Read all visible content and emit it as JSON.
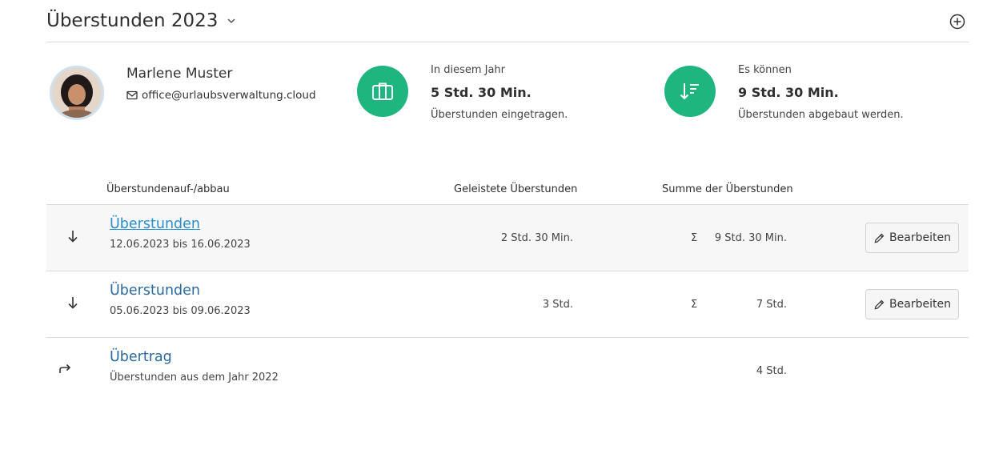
{
  "header": {
    "title": "Überstunden 2023"
  },
  "person": {
    "name": "Marlene Muster",
    "email": "office@urlaubsverwaltung.cloud"
  },
  "stats": {
    "year": {
      "label": "In diesem Jahr",
      "value": "5 Std. 30 Min.",
      "desc": "Überstunden eingetragen."
    },
    "reducible": {
      "label": "Es können",
      "value": "9 Std. 30 Min.",
      "desc": "Überstunden abgebaut werden."
    }
  },
  "colors": {
    "accent_green": "#1fb57f",
    "link_blue": "#2b6a9f"
  },
  "table": {
    "columns": {
      "type": "Überstundenauf-/abbau",
      "worked": "Geleistete Überstunden",
      "sum": "Summe der Überstunden"
    },
    "rows": [
      {
        "icon": "arrow-down-icon",
        "title": "Überstunden",
        "subtitle": "12.06.2023 bis 16.06.2023",
        "worked": "2 Std. 30 Min.",
        "sigma": "Σ",
        "sum": "9 Std. 30 Min.",
        "action": "Bearbeiten"
      },
      {
        "icon": "arrow-down-icon",
        "title": "Überstunden",
        "subtitle": "05.06.2023 bis 09.06.2023",
        "worked": "3 Std.",
        "sigma": "Σ",
        "sum": "7 Std.",
        "action": "Bearbeiten"
      },
      {
        "icon": "forward-arrow-icon",
        "title": "Übertrag",
        "subtitle": "Überstunden aus dem Jahr 2022",
        "sum": "4 Std."
      }
    ]
  }
}
